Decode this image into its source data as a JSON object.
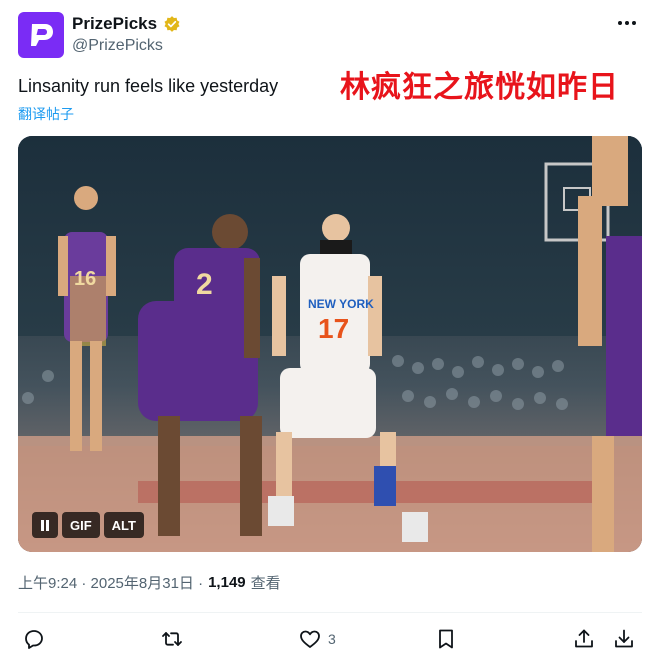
{
  "author": {
    "display_name": "PrizePicks",
    "handle": "@PrizePicks",
    "avatar_icon": "prizepicks-logo-icon",
    "avatar_color": "#7a2cf5",
    "verified_icon": "gold-verified-badge-icon",
    "verified_color": "#e2b719"
  },
  "tweet": {
    "text": "Linsanity run feels like yesterday",
    "translate_link": "翻译帖子",
    "overlay_caption": "林疯狂之旅恍如昨日"
  },
  "media": {
    "type": "gif",
    "pause_icon": "pause-icon",
    "gif_label": "GIF",
    "alt_label": "ALT",
    "jersey_numbers": [
      "16",
      "2",
      "17"
    ],
    "team_text": "NEW YORK"
  },
  "meta": {
    "timestamp": "上午9:24 · 2025年8月31日 ·",
    "views_count": "1,149",
    "views_label": "查看"
  },
  "actions": {
    "reply_icon": "reply-icon",
    "retweet_icon": "retweet-icon",
    "like_icon": "heart-icon",
    "like_count": "3",
    "bookmark_icon": "bookmark-icon",
    "share_icon": "share-icon",
    "download_icon": "download-icon"
  },
  "more_icon": "more-horizontal-icon",
  "colors": {
    "link_blue": "#1d9bf0",
    "secondary_text": "#536471",
    "caption_red": "#e8141b"
  }
}
